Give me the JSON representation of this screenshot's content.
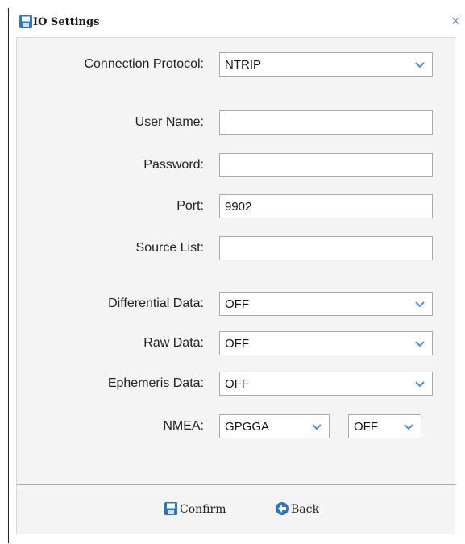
{
  "dialog": {
    "title": "IO Settings",
    "close_glyph": "×",
    "title_icon": "save-icon"
  },
  "form": {
    "connection_protocol": {
      "label": "Connection Protocol:",
      "value": "NTRIP"
    },
    "user_name": {
      "label": "User Name:",
      "value": ""
    },
    "password": {
      "label": "Password:",
      "value": ""
    },
    "port": {
      "label": "Port:",
      "value": "9902"
    },
    "source_list": {
      "label": "Source List:",
      "value": ""
    },
    "differential_data": {
      "label": "Differential Data:",
      "value": "OFF"
    },
    "raw_data": {
      "label": "Raw Data:",
      "value": "OFF"
    },
    "ephemeris_data": {
      "label": "Ephemeris Data:",
      "value": "OFF"
    },
    "nmea": {
      "label": "NMEA:",
      "sentence": "GPGGA",
      "rate": "OFF"
    }
  },
  "footer": {
    "confirm_label": "Confirm",
    "confirm_icon": "save-icon",
    "back_label": "Back",
    "back_icon": "back-arrow-icon"
  },
  "colors": {
    "chevron": "#4a90d9",
    "icon_blue": "#2d74c4",
    "panel_bg": "#f4f4f4"
  }
}
